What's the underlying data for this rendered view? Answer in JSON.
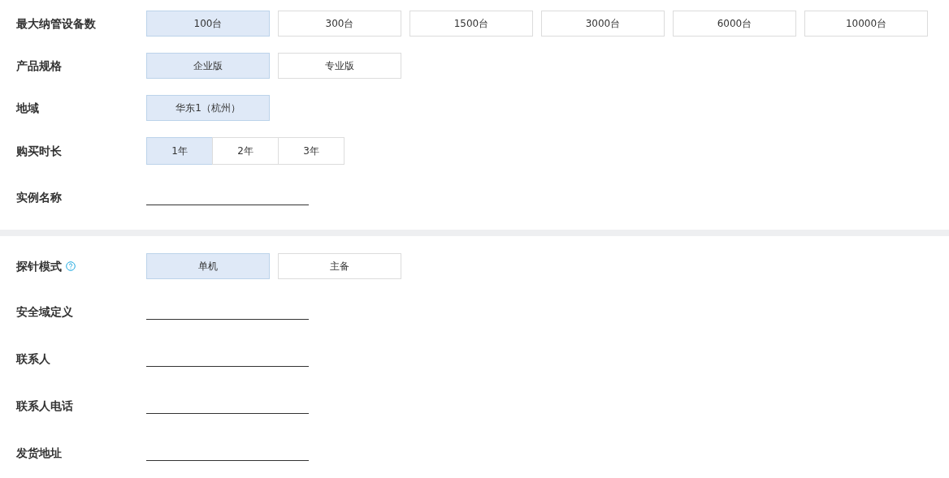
{
  "sections": [
    {
      "fields": [
        {
          "label": "最大纳管设备数",
          "kind": "options",
          "options": [
            {
              "label": "100台",
              "selected": true
            },
            {
              "label": "300台",
              "selected": false
            },
            {
              "label": "1500台",
              "selected": false
            },
            {
              "label": "3000台",
              "selected": false
            },
            {
              "label": "6000台",
              "selected": false
            },
            {
              "label": "10000台",
              "selected": false
            }
          ]
        },
        {
          "label": "产品规格",
          "kind": "options",
          "options": [
            {
              "label": "企业版",
              "selected": true
            },
            {
              "label": "专业版",
              "selected": false
            }
          ]
        },
        {
          "label": "地域",
          "kind": "options",
          "options": [
            {
              "label": "华东1（杭州）",
              "selected": true
            }
          ]
        },
        {
          "label": "购买时长",
          "kind": "segmented",
          "options": [
            {
              "label": "1年",
              "selected": true
            },
            {
              "label": "2年",
              "selected": false
            },
            {
              "label": "3年",
              "selected": false
            }
          ]
        },
        {
          "label": "实例名称",
          "kind": "text_input"
        }
      ]
    },
    {
      "fields": [
        {
          "label": "探针模式",
          "help": true,
          "kind": "options",
          "options": [
            {
              "label": "单机",
              "selected": true
            },
            {
              "label": "主备",
              "selected": false
            }
          ]
        },
        {
          "label": "安全域定义",
          "kind": "text_input"
        },
        {
          "label": "联系人",
          "kind": "text_input"
        },
        {
          "label": "联系人电话",
          "kind": "text_input"
        },
        {
          "label": "发货地址",
          "kind": "text_input"
        }
      ]
    }
  ]
}
